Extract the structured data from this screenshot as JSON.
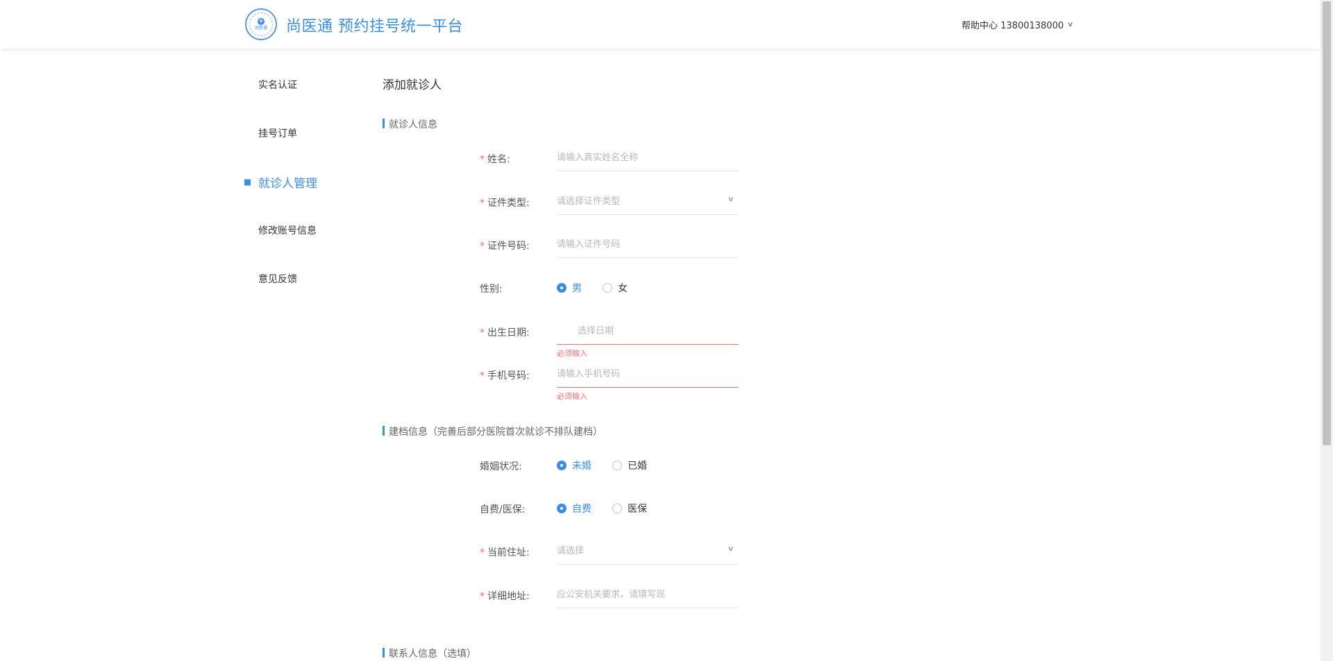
{
  "header": {
    "logo_text": "尚医通",
    "site_title": "尚医通 预约挂号统一平台",
    "user_menu": "帮助中心 13800138000"
  },
  "nav": {
    "items": [
      {
        "label": "实名认证"
      },
      {
        "label": "挂号订单"
      },
      {
        "label": "就诊人管理",
        "active": true
      },
      {
        "label": "修改账号信息"
      },
      {
        "label": "意见反馈"
      }
    ]
  },
  "form": {
    "page_title": "添加就诊人",
    "section_patient": "就诊人信息",
    "name": {
      "label": "姓名:",
      "placeholder": "请输入真实姓名全称"
    },
    "cert_type": {
      "label": "证件类型:",
      "placeholder": "请选择证件类型"
    },
    "cert_no": {
      "label": "证件号码:",
      "placeholder": "请输入证件号码"
    },
    "sex": {
      "label": "性别:",
      "options": [
        "男",
        "女"
      ],
      "selected": "男"
    },
    "birthdate": {
      "label": "出生日期:",
      "placeholder": "选择日期",
      "error": "必须输入"
    },
    "phone": {
      "label": "手机号码:",
      "placeholder": "请输入手机号码",
      "error": "必须输入"
    },
    "section_record": "建档信息（完善后部分医院首次就诊不排队建档）",
    "marital": {
      "label": "婚姻状况:",
      "options": [
        "未婚",
        "已婚"
      ],
      "selected": "未婚"
    },
    "insurance": {
      "label": "自费/医保:",
      "options": [
        "自费",
        "医保"
      ],
      "selected": "自费"
    },
    "address": {
      "label": "当前住址:",
      "placeholder": "请选择"
    },
    "address_detail": {
      "label": "详细地址:",
      "placeholder": "应公安机关要求，请填写现"
    },
    "section_contact": "联系人信息（选填）"
  },
  "colors": {
    "accent": "#3a8ee6",
    "error": "#f56c6c"
  }
}
